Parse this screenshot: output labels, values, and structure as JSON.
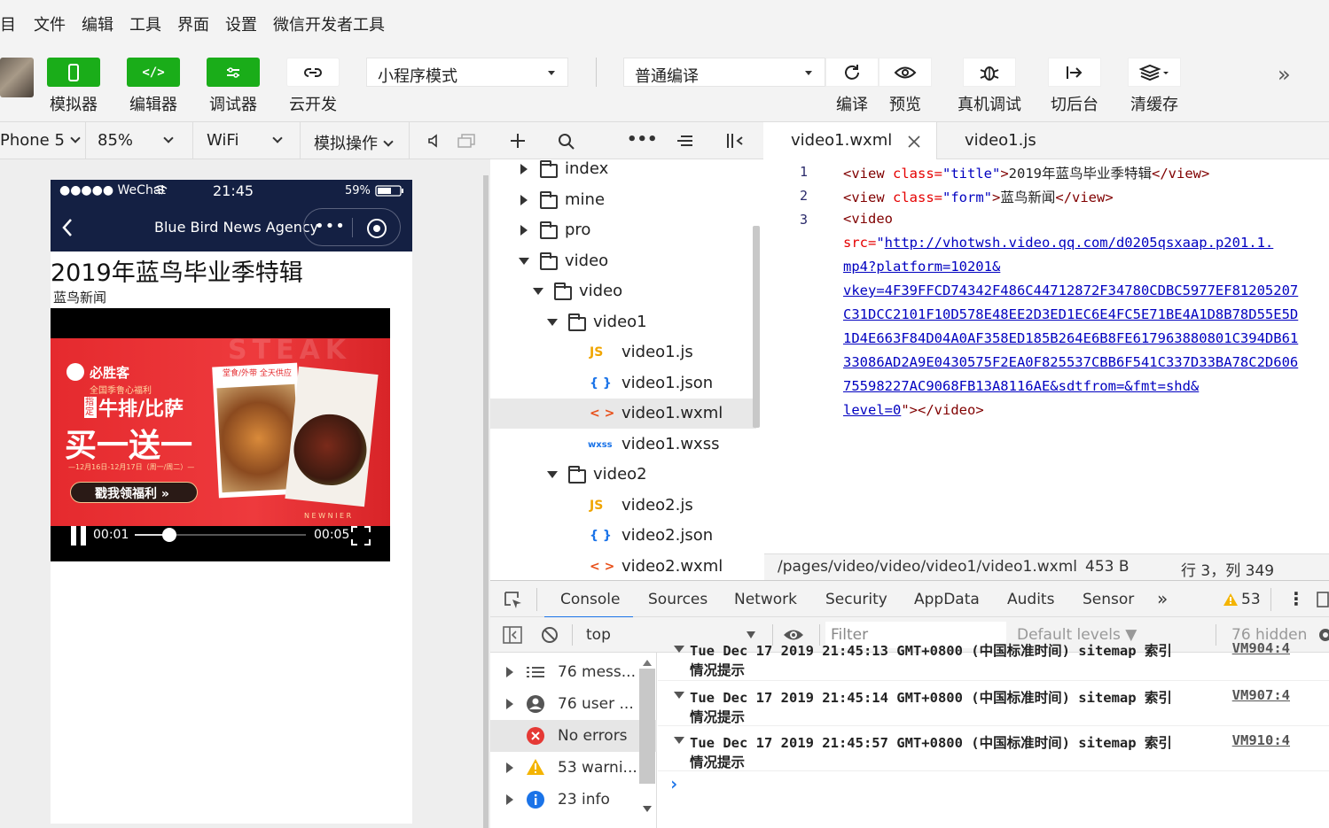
{
  "menu": [
    "目",
    "文件",
    "编辑",
    "工具",
    "界面",
    "设置",
    "微信开发者工具"
  ],
  "toolbar": {
    "simulator": "模拟器",
    "editor": "编辑器",
    "debugger": "调试器",
    "cloud": "云开发",
    "mode_select": "小程序模式",
    "compile_select": "普通编译",
    "compile": "编译",
    "preview": "预览",
    "real_debug": "真机调试",
    "background": "切后台",
    "clear_cache": "清缓存"
  },
  "simbar": {
    "device": "Phone 5",
    "zoom": "85%",
    "network": "WiFi",
    "ops": "模拟操作"
  },
  "phone": {
    "carrier": "●●●●● WeChat",
    "time": "21:45",
    "battery": "59%",
    "nav_title": "Blue Bird News Agency",
    "page_title": "2019年蓝鸟毕业季特辑",
    "form_text": "蓝鸟新闻",
    "video_current": "00:01",
    "video_total": "00:05",
    "video_progress": 0.2,
    "ad": {
      "brand": "必胜客",
      "line1": "全国季鲁心福利",
      "tag": "指定",
      "line2": "牛排/比萨",
      "line3": "买一送一",
      "date": "—12月16日-12月17日（周一/周二）—",
      "button": "戳我领福利 »",
      "food_label": "堂食/外带 全天供应",
      "bg_text": "STEAK",
      "bottom_text": "N E W  N I E R"
    }
  },
  "filetree": {
    "rows": [
      {
        "type": "folder",
        "name": "index",
        "open": false,
        "depth": 0
      },
      {
        "type": "folder",
        "name": "mine",
        "open": false,
        "depth": 0
      },
      {
        "type": "folder",
        "name": "pro",
        "open": false,
        "depth": 0
      },
      {
        "type": "folder",
        "name": "video",
        "open": true,
        "depth": 0
      },
      {
        "type": "folder",
        "name": "video",
        "open": true,
        "depth": 1
      },
      {
        "type": "folder",
        "name": "video1",
        "open": true,
        "depth": 2
      },
      {
        "type": "js",
        "name": "video1.js",
        "depth": 3,
        "badge": "JS"
      },
      {
        "type": "json",
        "name": "video1.json",
        "depth": 3,
        "badge": "{ }"
      },
      {
        "type": "wxml",
        "name": "video1.wxml",
        "depth": 3,
        "badge": "< >",
        "selected": true
      },
      {
        "type": "wxss",
        "name": "video1.wxss",
        "depth": 3,
        "badge": "wxss"
      },
      {
        "type": "folder",
        "name": "video2",
        "open": true,
        "depth": 2
      },
      {
        "type": "js",
        "name": "video2.js",
        "depth": 3,
        "badge": "JS"
      },
      {
        "type": "json",
        "name": "video2.json",
        "depth": 3,
        "badge": "{ }"
      },
      {
        "type": "wxml",
        "name": "video2.wxml",
        "depth": 3,
        "badge": "< >"
      }
    ]
  },
  "editor": {
    "tabs": [
      "video1.wxml",
      "video1.js"
    ],
    "line_numbers": [
      "1",
      "2",
      "3"
    ],
    "line1": {
      "open": "<view ",
      "attr": "class=",
      "val": "\"title\"",
      "close": ">",
      "text": "2019年蓝鸟毕业季特辑",
      "end": "</view>"
    },
    "line2": {
      "open": "<view ",
      "attr": "class=",
      "val": "\"form\"",
      "close": ">",
      "text": "蓝鸟新闻",
      "end": "</view>"
    },
    "line3": "<video",
    "src_attr": "src=",
    "src_quote": "\"",
    "src_lines": [
      "http://vhotwsh.video.qq.com/d0205qsxaap.p201.1.",
      "mp4?platform=10201&",
      "vkey=4F39FFCD74342F486C44712872F34780CDBC5977EF81205207",
      "C31DCC2101F10D578E48EE2D3ED1EC6E4FC5E71BE4A1D8B78D55E5D",
      "1D4E663F84D04A0AF358ED185B264E6B8FE617963880801C394DB61",
      "33086AD2A9E0430575F2EA0F825537CBB6F541C337D33BA78C2D606",
      "75598227AC9068FB13A8116AE&sdtfrom=&fmt=shd&",
      "level=0"
    ],
    "src_end": "\"></video>",
    "status_path": "/pages/video/video/video1/video1.wxml",
    "status_size": "453 B",
    "status_pos": "行 3，列 349"
  },
  "devtools": {
    "tabs": [
      "Console",
      "Sources",
      "Network",
      "Security",
      "AppData",
      "Audits",
      "Sensor"
    ],
    "more": "»",
    "warnings": "53",
    "context": "top",
    "filter_placeholder": "Filter",
    "levels": "Default levels ▼",
    "hidden": "76 hidden",
    "side": [
      {
        "label": "76 mess...",
        "icon": "list"
      },
      {
        "label": "76 user ...",
        "icon": "user"
      },
      {
        "label": "No errors",
        "icon": "error"
      },
      {
        "label": "53 warni...",
        "icon": "warning"
      },
      {
        "label": "23 info",
        "icon": "info"
      }
    ],
    "logs": [
      {
        "line1": "Tue Dec 17 2019 21:45:13 GMT+0800 (中国标准时间) sitemap 索引",
        "line2": "情况提示",
        "src": "VM904:4"
      },
      {
        "line1": "Tue Dec 17 2019 21:45:14 GMT+0800 (中国标准时间) sitemap 索引",
        "line2": "情况提示",
        "src": "VM907:4"
      },
      {
        "line1": "Tue Dec 17 2019 21:45:57 GMT+0800 (中国标准时间) sitemap 索引",
        "line2": "情况提示",
        "src": "VM910:4"
      }
    ],
    "prompt": "›"
  },
  "colors": {
    "green": "#1aad19",
    "navy": "#142043",
    "ad_red": "#e52a2e"
  }
}
